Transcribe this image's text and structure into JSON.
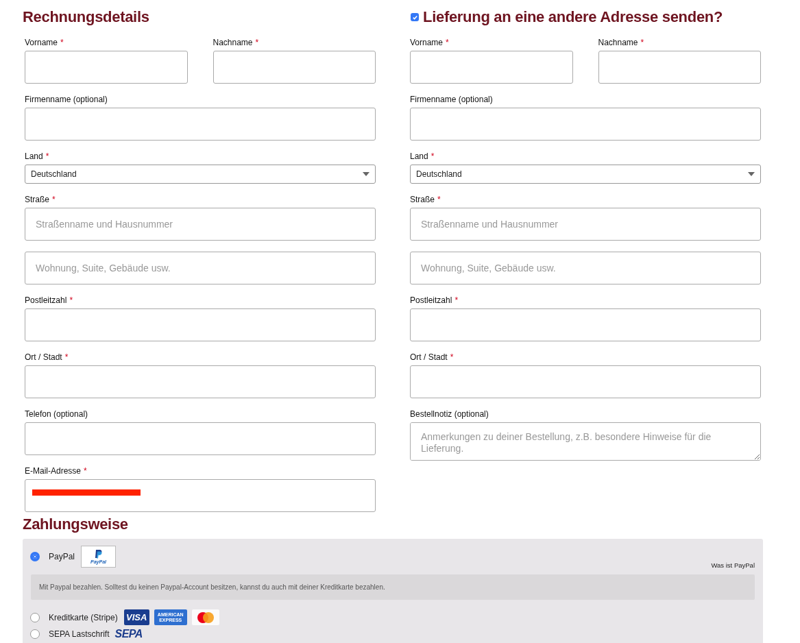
{
  "billing": {
    "title": "Rechnungsdetails",
    "rows": [
      {
        "fields": [
          {
            "kind": "text",
            "label": "Vorname",
            "required_mark": "*"
          },
          {
            "kind": "text",
            "label": "Nachname",
            "required_mark": "*"
          }
        ]
      },
      {
        "fields": [
          {
            "kind": "text",
            "label": "Firmenname (optional)"
          }
        ]
      },
      {
        "fields": [
          {
            "kind": "select",
            "label": "Land",
            "required_mark": "*",
            "value": "Deutschland"
          }
        ]
      },
      {
        "fields": [
          {
            "kind": "text",
            "label": "Straße",
            "required_mark": "*",
            "placeholder": "Straßenname und Hausnummer"
          }
        ]
      },
      {
        "fields": [
          {
            "kind": "text",
            "placeholder": "Wohnung, Suite, Gebäude usw."
          }
        ]
      },
      {
        "fields": [
          {
            "kind": "text",
            "label": "Postleitzahl",
            "required_mark": "*"
          }
        ]
      },
      {
        "fields": [
          {
            "kind": "text",
            "label": "Ort / Stadt",
            "required_mark": "*"
          }
        ]
      },
      {
        "fields": [
          {
            "kind": "text",
            "label": "Telefon (optional)"
          }
        ]
      },
      {
        "fields": [
          {
            "kind": "text",
            "label": "E-Mail-Adresse",
            "required_mark": "*",
            "redacted": true
          }
        ]
      }
    ]
  },
  "shipping": {
    "title": "Lieferung an eine andere Adresse senden?",
    "checkbox": {
      "checked": true
    },
    "rows": [
      {
        "fields": [
          {
            "kind": "text",
            "label": "Vorname",
            "required_mark": "*"
          },
          {
            "kind": "text",
            "label": "Nachname",
            "required_mark": "*"
          }
        ]
      },
      {
        "fields": [
          {
            "kind": "text",
            "label": "Firmenname (optional)"
          }
        ]
      },
      {
        "fields": [
          {
            "kind": "select",
            "label": "Land",
            "required_mark": "*",
            "value": "Deutschland"
          }
        ]
      },
      {
        "fields": [
          {
            "kind": "text",
            "label": "Straße",
            "required_mark": "*",
            "placeholder": "Straßenname und Hausnummer"
          }
        ]
      },
      {
        "fields": [
          {
            "kind": "text",
            "placeholder": "Wohnung, Suite, Gebäude usw."
          }
        ]
      },
      {
        "fields": [
          {
            "kind": "text",
            "label": "Postleitzahl",
            "required_mark": "*"
          }
        ]
      },
      {
        "fields": [
          {
            "kind": "text",
            "label": "Ort / Stadt",
            "required_mark": "*"
          }
        ]
      },
      {
        "fields": [
          {
            "kind": "textarea",
            "label": "Bestellnotiz (optional)",
            "placeholder": "Anmerkungen zu deiner Bestellung, z.B. besondere Hinweise für die Lieferung."
          }
        ]
      }
    ]
  },
  "payment": {
    "title": "Zahlungsweise",
    "methods": [
      {
        "label": "PayPal",
        "selected": true,
        "logos": [
          {
            "kind": "paypal",
            "text": "PayPal"
          }
        ],
        "info_link": "Was ist PayPal",
        "description": "Mit Paypal bezahlen. Solltest du keinen Paypal-Account besitzen, kannst du auch mit deiner Kreditkarte bezahlen."
      },
      {
        "label": "Kreditkarte (Stripe)",
        "selected": false,
        "logos": [
          {
            "kind": "visa",
            "text": "VISA"
          },
          {
            "kind": "amex",
            "text": "AMERICAN EXPRESS"
          },
          {
            "kind": "circles"
          }
        ]
      },
      {
        "label": "SEPA Lastschrift",
        "selected": false,
        "logos": [
          {
            "kind": "sepa",
            "text": "SEPA"
          }
        ]
      }
    ]
  }
}
